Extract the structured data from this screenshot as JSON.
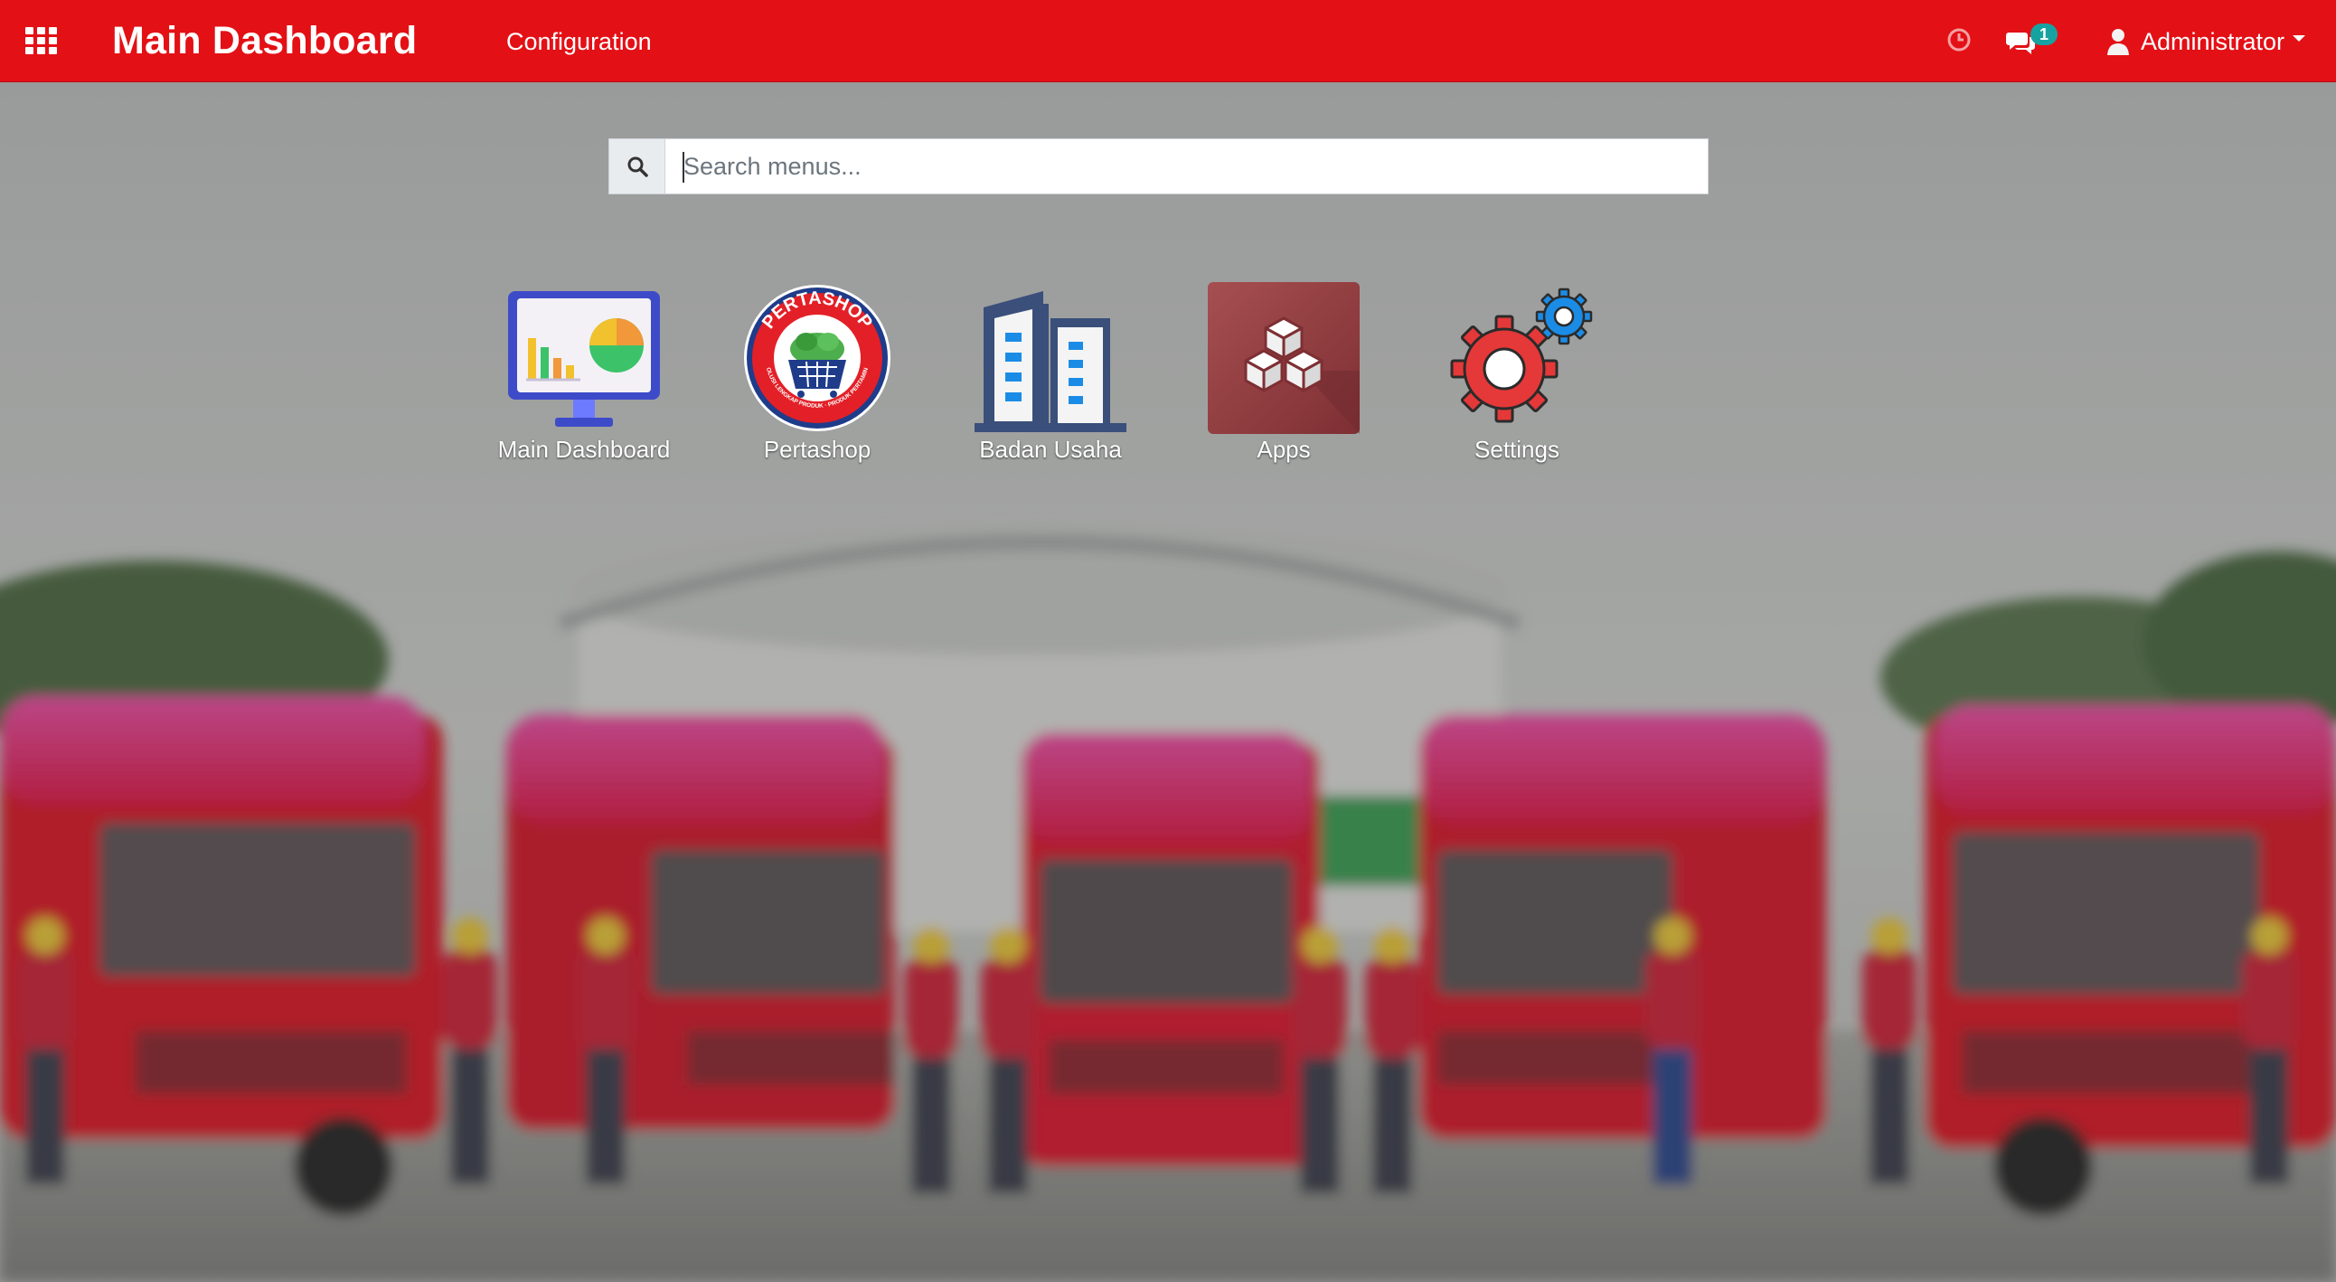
{
  "navbar": {
    "brand": "Main Dashboard",
    "menu_items": [
      {
        "label": "Configuration"
      }
    ],
    "chat_badge_count": "1",
    "user_name": "Administrator",
    "color": "#e31016"
  },
  "search": {
    "placeholder": "Search menus...",
    "value": ""
  },
  "apps": [
    {
      "label": "Main Dashboard",
      "icon": "dashboard-monitor-chart-icon"
    },
    {
      "label": "Pertashop",
      "icon": "pertashop-logo"
    },
    {
      "label": "Badan Usaha",
      "icon": "office-buildings-icon"
    },
    {
      "label": "Apps",
      "icon": "cubes-icon"
    },
    {
      "label": "Settings",
      "icon": "gears-icon"
    }
  ],
  "pertashop_logo": {
    "top_text": "PERTASHOP",
    "ring_text": "SOLUSI LENGKAP PRODUK · PRODUK PERTAMINA"
  }
}
